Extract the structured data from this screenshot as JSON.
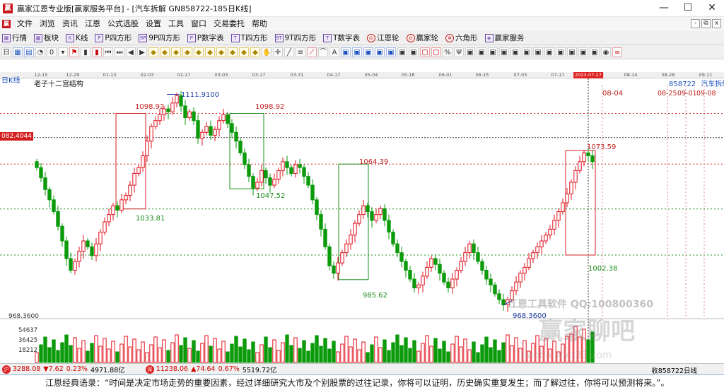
{
  "window": {
    "title": "赢家江恩专业版[赢家服务平台] - [汽车拆解  GN858722-185日K线]",
    "controls": [
      "—",
      "☐",
      "✕"
    ]
  },
  "menu": {
    "items": [
      "文件",
      "浏览",
      "资讯",
      "江恩",
      "公式选股",
      "设置",
      "工具",
      "窗口",
      "交易委托",
      "帮助"
    ],
    "mdi": [
      "-",
      "⧉",
      "x"
    ]
  },
  "toolbar1": {
    "items": [
      {
        "icon": "▦",
        "label": "行情"
      },
      {
        "icon": "▦",
        "label": "板块"
      },
      {
        "icon": "K",
        "label": "K线"
      },
      {
        "icon": "P",
        "label": "P四方形"
      },
      {
        "icon": "9P",
        "label": "9P四方形"
      },
      {
        "icon": "P",
        "label": "P数字表"
      },
      {
        "icon": "T",
        "label": "T四方形"
      },
      {
        "icon": "9T",
        "label": "9T四方形"
      },
      {
        "icon": "T",
        "label": "T数字表"
      },
      {
        "icon": "◎",
        "label": "江恩轮"
      },
      {
        "icon": "◎",
        "label": "赢家轮"
      },
      {
        "icon": "✲",
        "label": "六角形"
      },
      {
        "icon": "◈",
        "label": "赢家服务"
      }
    ]
  },
  "chart_header": {
    "period": "日K线",
    "indicator": "老子十二宫结构",
    "symbol": "858722",
    "name": "汽车拆解"
  },
  "price_markers": {
    "current": "082.4044",
    "bottom": "968.3600"
  },
  "volume_axis": [
    "54637",
    "36425",
    "18212"
  ],
  "watermark": {
    "line1": "江恩工具软件  QQ:100800360",
    "line2": "赢家聊吧",
    "line3": "liaoba.wv.t33.com"
  },
  "date_axis": [
    {
      "label": "12-15"
    },
    {
      "label": "12-29"
    },
    {
      "label": "01-13"
    },
    {
      "label": "02-03"
    },
    {
      "label": "02-17"
    },
    {
      "label": "03-03"
    },
    {
      "label": "03-17"
    },
    {
      "label": "03-31"
    },
    {
      "label": "04-17"
    },
    {
      "label": "05-04"
    },
    {
      "label": "05-18"
    },
    {
      "label": "06-01"
    },
    {
      "label": "06-15"
    },
    {
      "label": "07-03"
    },
    {
      "label": "07-17"
    },
    {
      "label": "2023-07-27",
      "highlight": true
    },
    {
      "label": "08-14"
    },
    {
      "label": "08-28"
    },
    {
      "label": "09-11"
    }
  ],
  "annotations": {
    "a1": "1111.9100",
    "a2": "1098.92",
    "a3": "1098.92",
    "a4": "1033.81",
    "a5": "1047.52",
    "a6": "1064.39",
    "a7": "985.62",
    "a8": "1073.59",
    "a9": "1002.38",
    "a10": "968.3600",
    "d1": "08-04",
    "d2": "08-25",
    "d3": "09-01",
    "d4": "09-08"
  },
  "statusbar": {
    "sh": {
      "badge": "沪",
      "index": "3288.08",
      "change": "▼7.62",
      "pct": "0.23%",
      "amount": "4971.88亿"
    },
    "sz": {
      "badge": "深",
      "index": "11238.06",
      "change": "▲74.64",
      "pct": "0.67%",
      "amount": "5519.72亿"
    },
    "right": "收858722日线"
  },
  "tip": "江恩经典语录：“时间是决定市场走势的重要因素，经过详细研究大市及个别股票的过往记录，你将可以证明，历史确实重复发生；而了解过往，你将可以预测将来。”。",
  "colors": {
    "up": "#e0101c",
    "down": "#0a9a0a",
    "box_red": "#d42020",
    "box_green": "#1a8c1a",
    "accent": "#1a4fc0"
  },
  "chart_data": {
    "type": "candlestick",
    "title": "",
    "x_dates": [
      "12-15",
      "12-29",
      "01-13",
      "02-03",
      "02-17",
      "03-03",
      "03-17",
      "03-31",
      "04-17",
      "05-04",
      "05-18",
      "06-01",
      "06-15",
      "07-03",
      "07-17",
      "2023-07-27",
      "08-14",
      "08-28",
      "09-11"
    ],
    "y_range": [
      960,
      1116
    ],
    "series": [
      {
        "name": "858722",
        "closes": [
          1062,
          1055,
          1047,
          1040,
          1032,
          1022,
          1012,
          1000,
          992,
          998,
          1005,
          1012,
          1008,
          1002,
          1010,
          1018,
          1025,
          1030,
          1036,
          1033,
          1040,
          1043,
          1050,
          1058,
          1062,
          1070,
          1080,
          1090,
          1094,
          1098,
          1102,
          1100,
          1106,
          1111,
          1104,
          1096,
          1100,
          1094,
          1082,
          1086,
          1090,
          1084,
          1088,
          1094,
          1098,
          1092,
          1086,
          1080,
          1072,
          1064,
          1056,
          1048,
          1052,
          1060,
          1055,
          1050,
          1054,
          1060,
          1066,
          1062,
          1058,
          1064,
          1062,
          1056,
          1050,
          1040,
          1030,
          1020,
          1008,
          995,
          990,
          997,
          1004,
          1010,
          1016,
          1024,
          1030,
          1036,
          1032,
          1026,
          1030,
          1034,
          1026,
          1018,
          1010,
          1004,
          998,
          992,
          986,
          980,
          982,
          988,
          994,
          1000,
          996,
          990,
          984,
          980,
          986,
          992,
          998,
          1004,
          1010,
          1004,
          998,
          992,
          986,
          982,
          976,
          972,
          968.4,
          972,
          978,
          984,
          990,
          994,
          1000,
          1004,
          1008,
          1012,
          1016,
          1020,
          1026,
          1032,
          1038,
          1044,
          1052,
          1060,
          1066,
          1072,
          1070,
          1066
        ],
        "volume_peak_labels": [
          "54637",
          "36425",
          "18212"
        ]
      }
    ],
    "levels": [
      {
        "label": "1111.9100",
        "kind": "high"
      },
      {
        "label": "1098.92",
        "kind": "box_top"
      },
      {
        "label": "1064.39",
        "kind": "box_top"
      },
      {
        "label": "1073.59",
        "kind": "box_top"
      },
      {
        "label": "1047.52",
        "kind": "box_bottom"
      },
      {
        "label": "1033.81",
        "kind": "box_bottom"
      },
      {
        "label": "1002.38",
        "kind": "box_bottom"
      },
      {
        "label": "985.62",
        "kind": "box_bottom"
      },
      {
        "label": "968.3600",
        "kind": "low"
      }
    ]
  }
}
